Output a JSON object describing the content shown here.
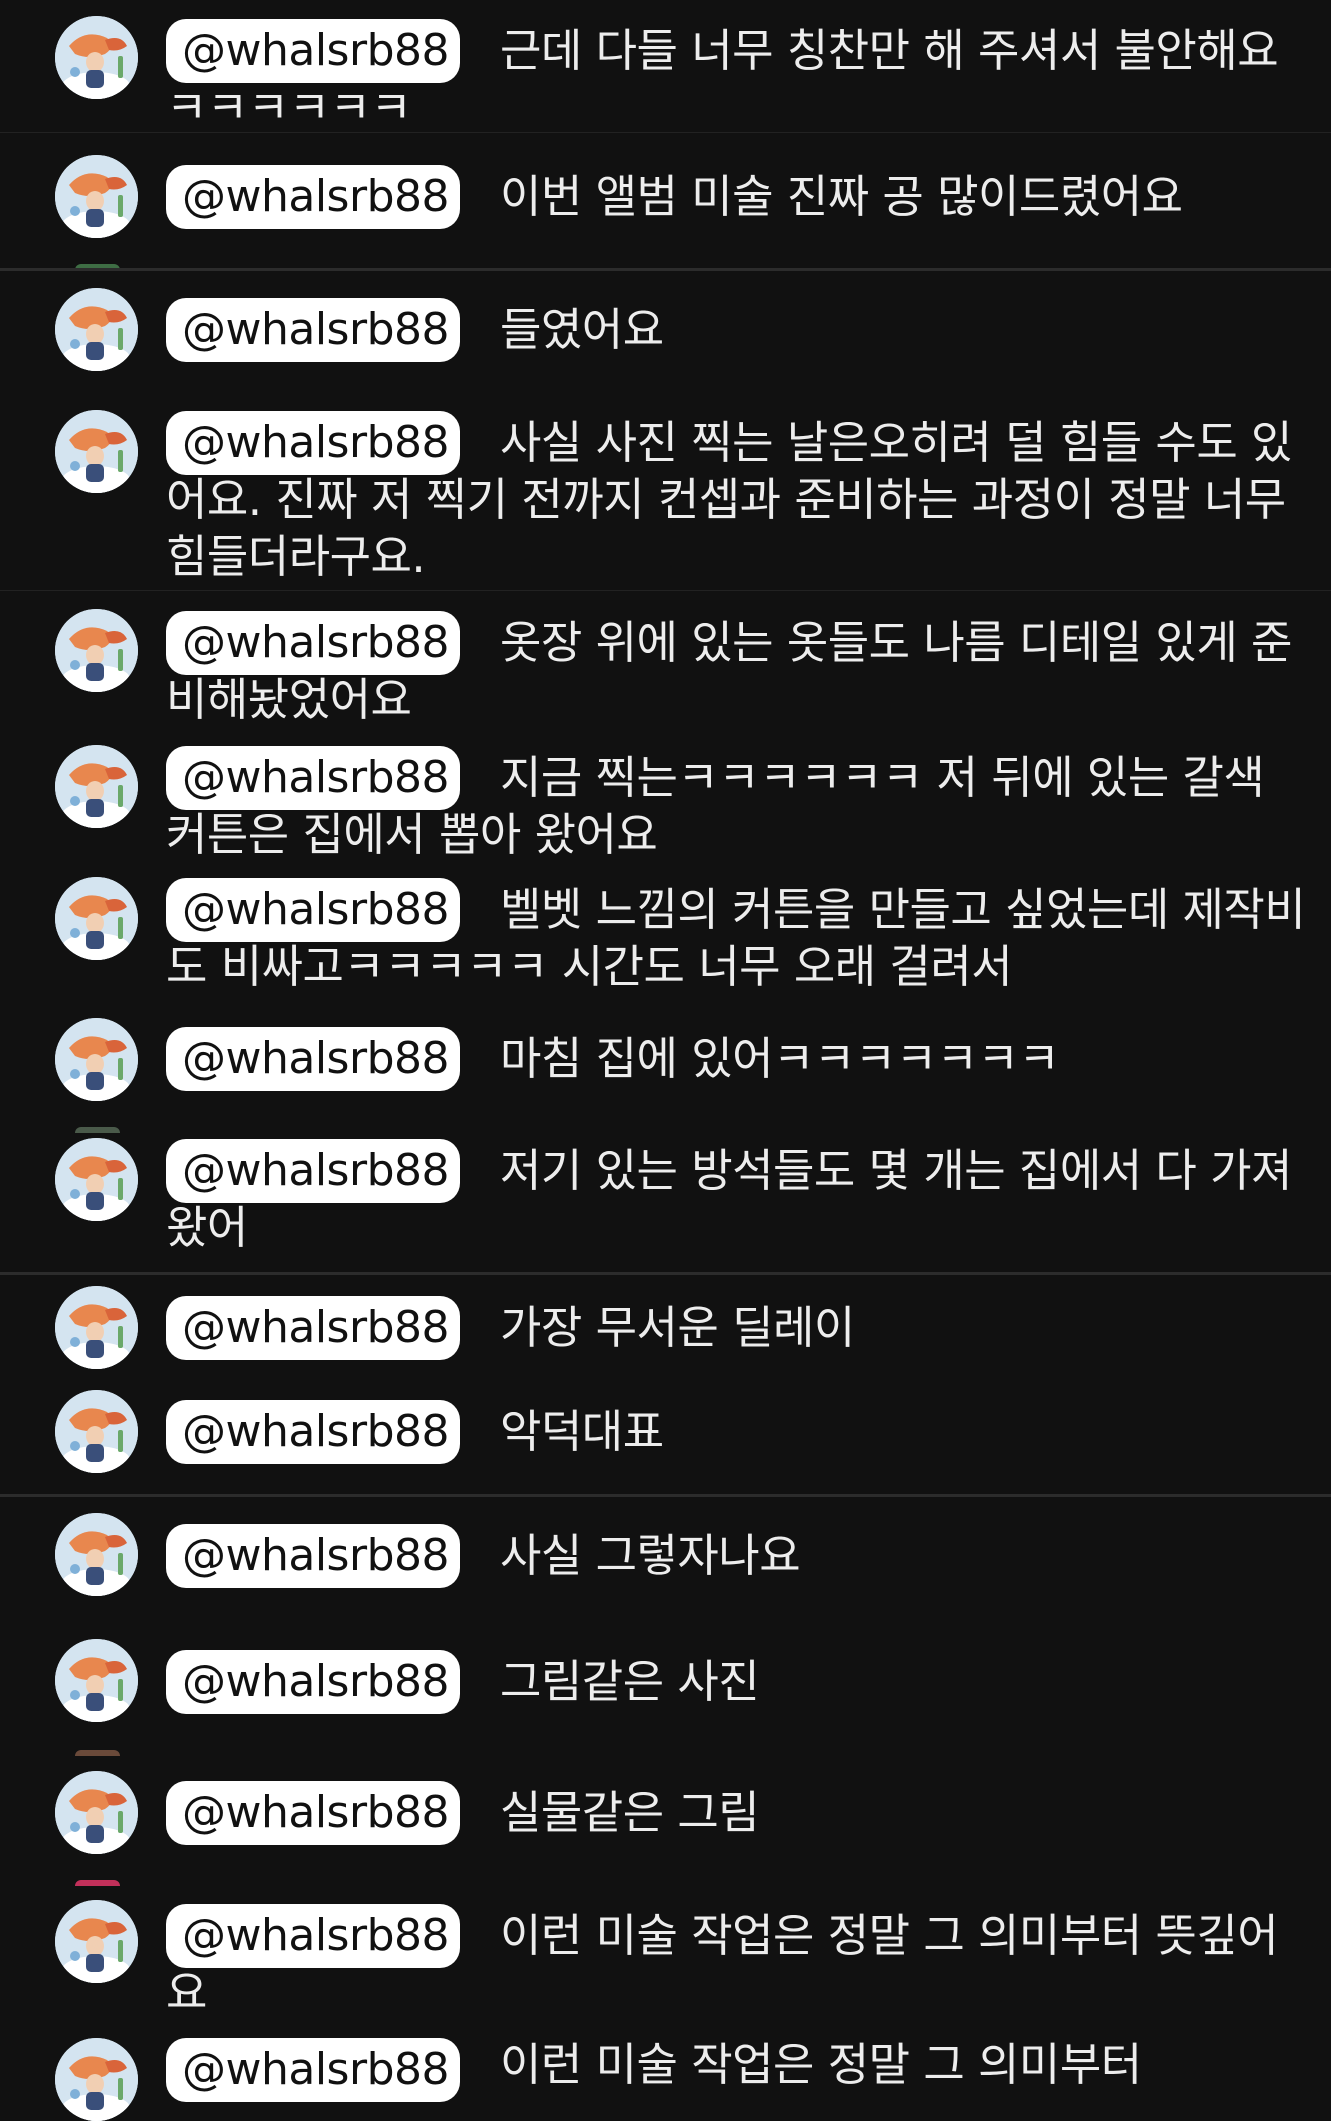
{
  "chat": {
    "messages": [
      {
        "username": "@whalsrb88",
        "text": "근데 다들 너무 칭찬만 해 주셔서 불안해요 ㅋㅋㅋㅋㅋㅋ"
      },
      {
        "username": "@whalsrb88",
        "text": "이번 앨범 미술 진짜 공 많이드렸어요"
      },
      {
        "username": "@whalsrb88",
        "text": "들였어요"
      },
      {
        "username": "@whalsrb88",
        "text": "사실 사진 찍는 날은오히려 덜 힘들 수도 있어요. 진짜 저 찍기 전까지 컨셉과 준비하는 과정이 정말 너무 힘들더라구요."
      },
      {
        "username": "@whalsrb88",
        "text": "옷장 위에 있는 옷들도 나름 디테일 있게 준비해놨었어요"
      },
      {
        "username": "@whalsrb88",
        "text": "지금 찍는ㅋㅋㅋㅋㅋㅋ 저 뒤에 있는 갈색 커튼은 집에서 뽑아 왔어요"
      },
      {
        "username": "@whalsrb88",
        "text": "벨벳 느낌의 커튼을 만들고 싶었는데 제작비도 비싸고ㅋㅋㅋㅋㅋ 시간도 너무 오래 걸려서"
      },
      {
        "username": "@whalsrb88",
        "text": "마침 집에 있어ㅋㅋㅋㅋㅋㅋㅋ"
      },
      {
        "username": "@whalsrb88",
        "text": "저기 있는 방석들도 몇 개는 집에서 다 가져왔어"
      },
      {
        "username": "@whalsrb88",
        "text": "가장 무서운 딜레이"
      },
      {
        "username": "@whalsrb88",
        "text": "악덕대표"
      },
      {
        "username": "@whalsrb88",
        "text": "사실 그렇자나요"
      },
      {
        "username": "@whalsrb88",
        "text": "그림같은 사진"
      },
      {
        "username": "@whalsrb88",
        "text": "실물같은 그림"
      },
      {
        "username": "@whalsrb88",
        "text": "이런 미술 작업은 정말 그 의미부터 뜻깊어요"
      },
      {
        "username": "@whalsrb88",
        "text": "이런 미술 작업은 정말 그 의미부터"
      }
    ]
  },
  "avatar_icon": "profile-illustration-icon",
  "colors": {
    "background": "#111111",
    "text": "#ededed",
    "handle_background": "#ffffff",
    "handle_text": "#111111",
    "divider": "#2c2c2c"
  }
}
